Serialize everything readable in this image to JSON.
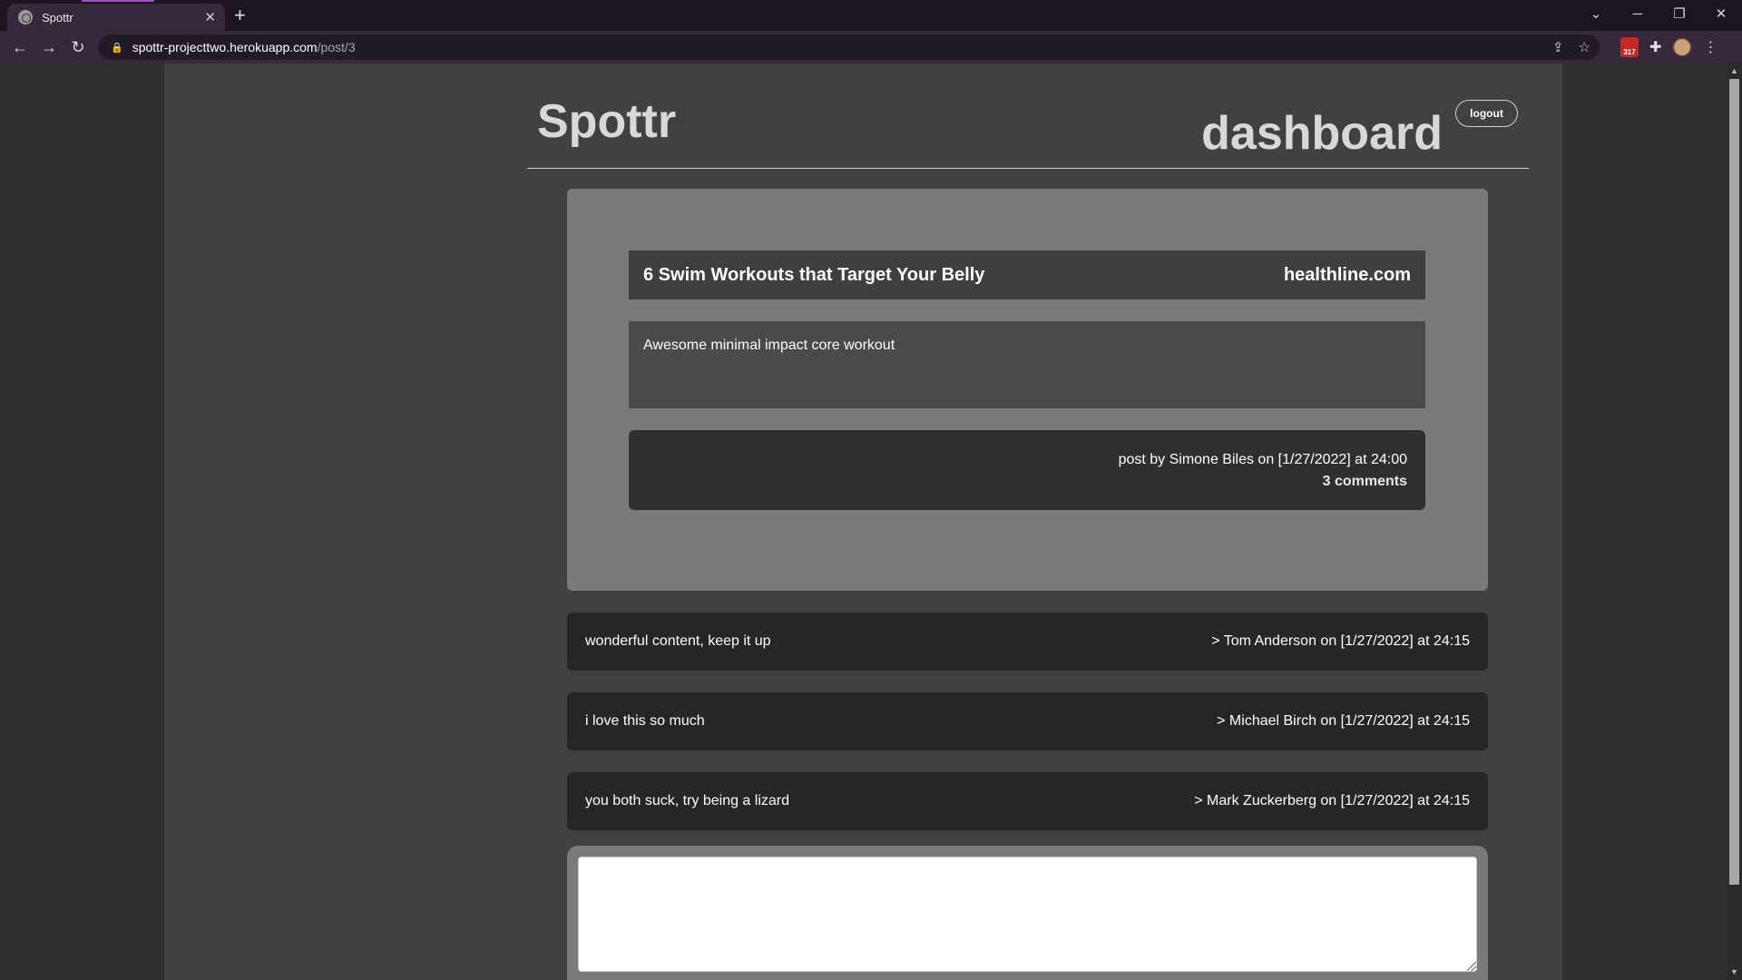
{
  "browser": {
    "tab_title": "Spottr",
    "url_host": "spottr-projecttwo.herokuapp.com",
    "url_path": "/post/3",
    "gmail_badge": "317"
  },
  "header": {
    "brand": "Spottr",
    "title": "dashboard",
    "logout_label": "logout"
  },
  "post": {
    "title": "6 Swim Workouts that Target Your Belly",
    "source": "healthline.com",
    "body": "Awesome minimal impact core workout",
    "meta": "post by Simone Biles on [1/27/2022] at 24:00",
    "comment_count": "3 comments"
  },
  "comments": [
    {
      "text": "wonderful content, keep it up",
      "meta": "> Tom Anderson on [1/27/2022] at 24:15"
    },
    {
      "text": "i love this so much",
      "meta": "> Michael Birch on [1/27/2022] at 24:15"
    },
    {
      "text": "you both suck, try being a lizard",
      "meta": "> Mark Zuckerberg on [1/27/2022] at 24:15"
    }
  ],
  "reply": {
    "value": ""
  },
  "colors": {
    "page_bg": "#414141",
    "card_bg": "#7a7a7a",
    "comment_bg": "#262626",
    "browser_chrome": "#35293b"
  }
}
